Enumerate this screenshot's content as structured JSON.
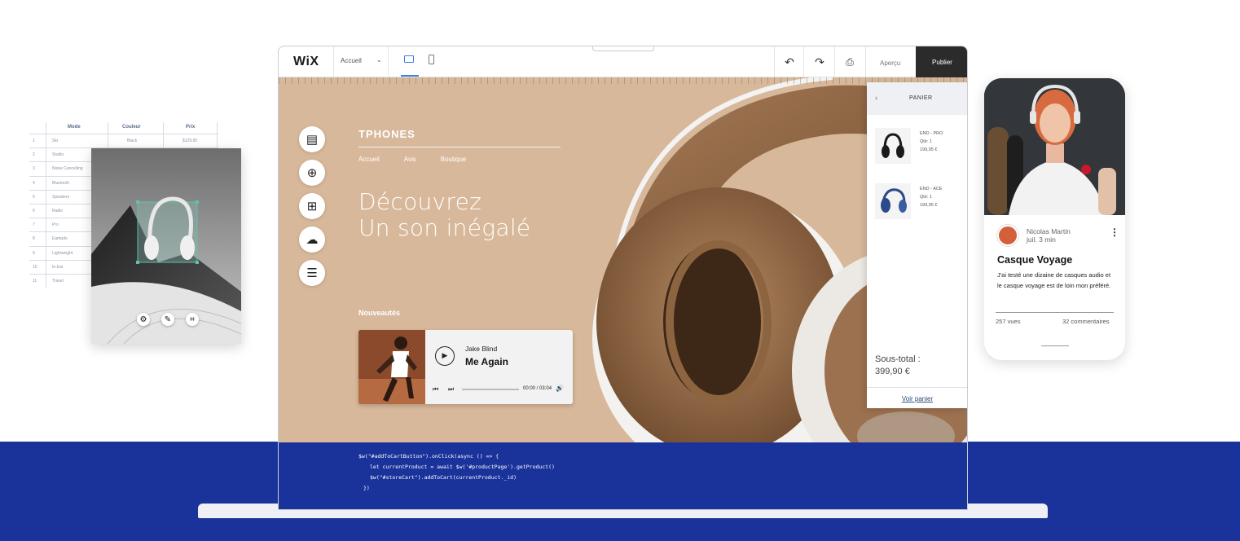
{
  "table": {
    "headers": [
      "Mode",
      "Couleur",
      "Prix"
    ],
    "rows": [
      {
        "n": "1",
        "mode": "Ski",
        "couleur": "Black",
        "prix": "$129.95"
      },
      {
        "n": "2",
        "mode": "Studio",
        "couleur": "",
        "prix": ""
      },
      {
        "n": "3",
        "mode": "Noise Cancelling",
        "couleur": "",
        "prix": ""
      },
      {
        "n": "4",
        "mode": "Bluetooth",
        "couleur": "",
        "prix": ""
      },
      {
        "n": "5",
        "mode": "Speakers",
        "couleur": "",
        "prix": ""
      },
      {
        "n": "6",
        "mode": "Radio",
        "couleur": "",
        "prix": ""
      },
      {
        "n": "7",
        "mode": "Pro",
        "couleur": "",
        "prix": ""
      },
      {
        "n": "8",
        "mode": "Earbuds",
        "couleur": "",
        "prix": ""
      },
      {
        "n": "9",
        "mode": "Lightweight",
        "couleur": "",
        "prix": ""
      },
      {
        "n": "10",
        "mode": "In-Ear",
        "couleur": "",
        "prix": ""
      },
      {
        "n": "11",
        "mode": "Travel",
        "couleur": "",
        "prix": ""
      }
    ]
  },
  "image_editor": {
    "tools": [
      "gear-icon",
      "pen-icon",
      "crop-icon"
    ]
  },
  "editor": {
    "logo": "WiX",
    "page_select": "Accueil",
    "preview_label": "Aperçu",
    "publish_label": "Publier",
    "toolbar_icons": [
      "undo-icon",
      "redo-icon",
      "save-icon"
    ]
  },
  "site": {
    "brand": "TPHONES",
    "nav": [
      "Accueil",
      "Avis",
      "Boutique"
    ],
    "hero_line1": "Découvrez",
    "hero_line2": "Un son inégalé",
    "news_label": "Nouveautés",
    "background_color": "#d8b89a"
  },
  "player": {
    "artist": "Jake Blind",
    "song": "Me Again",
    "time": "00:00 / 03:04",
    "progress": 0
  },
  "cart": {
    "title": "PANIER",
    "items": [
      {
        "name": "END - PRO",
        "qty": "Qté: 1",
        "price": "199,95 €"
      },
      {
        "name": "END - ACE",
        "qty": "Qté: 1",
        "price": "199,95 €"
      }
    ],
    "subtotal_label": "Sous-total :",
    "subtotal_value": "399,90 €",
    "view_cart": "Voir panier"
  },
  "code": {
    "line1": "$w(\"#addToCartButton\").onClick(async () => {",
    "line2": "let currentProduct = await $w('#productPage').getProduct()",
    "line3": "$w(\"#storeCart\").addToCart(currentProduct._id)",
    "line4": "})"
  },
  "blog_post": {
    "author": "Nicolas Martin",
    "date": "juil. 3 min",
    "title": "Casque Voyage",
    "body": "J'ai testé une dizaine de casques audio et le casque voyage est de loin mon préféré.",
    "views": "257 vues",
    "comments": "32 commentaires"
  },
  "colors": {
    "band": "#1a339b",
    "accent": "#3b7fe6",
    "publish_bg": "#2b2b2b"
  }
}
